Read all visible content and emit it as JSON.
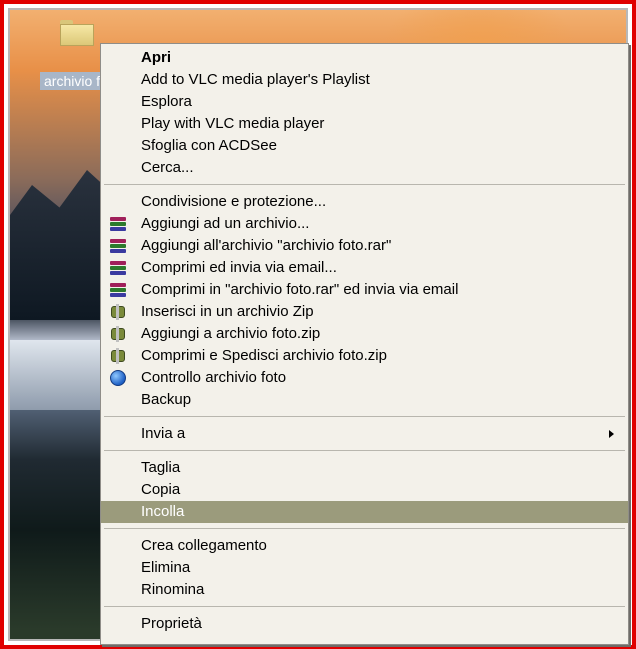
{
  "desktop": {
    "icon_label": "archivio foto"
  },
  "menu": {
    "groups": [
      [
        {
          "label": "Apri",
          "bold": true
        },
        {
          "label": "Add to VLC media player's Playlist"
        },
        {
          "label": "Esplora"
        },
        {
          "label": "Play with VLC media player"
        },
        {
          "label": "Sfoglia con ACDSee"
        },
        {
          "label": "Cerca..."
        }
      ],
      [
        {
          "label": "Condivisione e protezione..."
        },
        {
          "label": "Aggiungi ad un archivio...",
          "icon": "winrar-icon"
        },
        {
          "label": "Aggiungi all'archivio \"archivio foto.rar\"",
          "icon": "winrar-icon"
        },
        {
          "label": "Comprimi ed invia via email...",
          "icon": "winrar-icon"
        },
        {
          "label": "Comprimi in \"archivio foto.rar\" ed invia via email",
          "icon": "winrar-icon"
        },
        {
          "label": "Inserisci in un archivio Zip",
          "icon": "winzip-icon"
        },
        {
          "label": "Aggiungi a archivio foto.zip",
          "icon": "winzip-icon"
        },
        {
          "label": "Comprimi e Spedisci archivio foto.zip",
          "icon": "winzip-icon"
        },
        {
          "label": "Controllo archivio foto",
          "icon": "globe-icon"
        },
        {
          "label": "Backup"
        }
      ],
      [
        {
          "label": "Invia a",
          "submenu": true
        }
      ],
      [
        {
          "label": "Taglia"
        },
        {
          "label": "Copia"
        },
        {
          "label": "Incolla",
          "highlighted": true
        }
      ],
      [
        {
          "label": "Crea collegamento"
        },
        {
          "label": "Elimina"
        },
        {
          "label": "Rinomina"
        }
      ],
      [
        {
          "label": "Proprietà"
        }
      ]
    ]
  },
  "colors": {
    "frame": "#e00000",
    "menu_bg": "#f3f1ea",
    "highlight": "#9b9b7c"
  }
}
